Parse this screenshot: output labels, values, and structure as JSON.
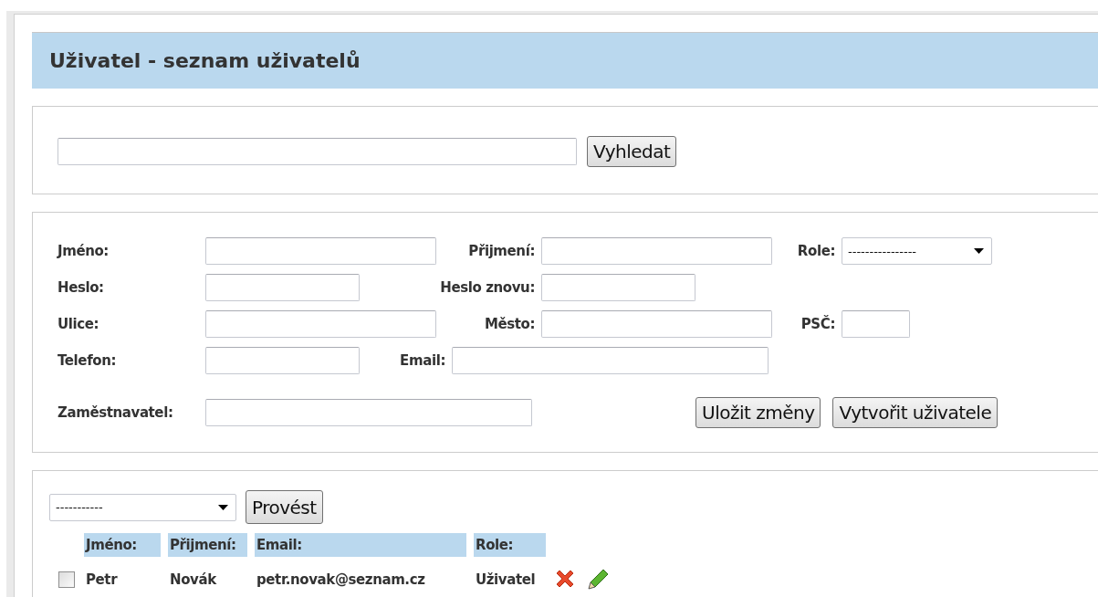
{
  "title": "Uživatel - seznam uživatelů",
  "search": {
    "button": "Vyhledat"
  },
  "form": {
    "rows": [
      [
        {
          "label": "Jméno:",
          "kind": "text"
        },
        {
          "label": "Přijmení:",
          "kind": "text"
        },
        {
          "label": "Role:",
          "kind": "select",
          "value": "----------------"
        }
      ],
      [
        {
          "label": "Heslo:",
          "kind": "text"
        },
        {
          "label": "Heslo znovu:",
          "kind": "text"
        }
      ],
      [
        {
          "label": "Ulice:",
          "kind": "text"
        },
        {
          "label": "Město:",
          "kind": "text"
        },
        {
          "label": "PSČ:",
          "kind": "text"
        }
      ],
      [
        {
          "label": "Telefon:",
          "kind": "text"
        },
        {
          "label": "Email:",
          "kind": "text"
        }
      ],
      [
        {
          "label": "Zaměstnavatel:",
          "kind": "text"
        }
      ]
    ],
    "buttons": [
      "Uložit změny",
      "Vytvořit uživatele"
    ]
  },
  "list": {
    "action_select": "-----------",
    "action_button": "Provést",
    "columns": [
      "Jméno:",
      "Přijmení:",
      "Email:",
      "Role:"
    ],
    "rows": [
      {
        "checked": false,
        "cells": [
          "Petr",
          "Novák",
          "petr.novak@seznam.cz",
          "Uživatel"
        ]
      }
    ]
  }
}
